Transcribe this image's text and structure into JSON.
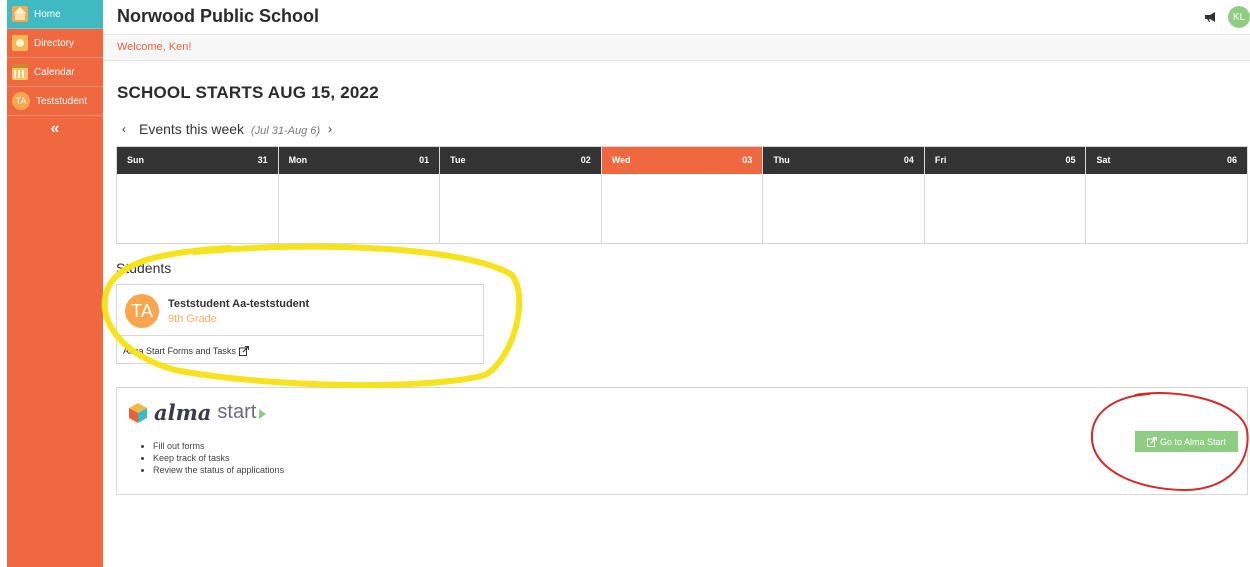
{
  "sidebar": {
    "items": [
      {
        "label": "Home",
        "icon": "home-icon"
      },
      {
        "label": "Directory",
        "icon": "directory-icon"
      },
      {
        "label": "Calendar",
        "icon": "calendar-icon"
      },
      {
        "label": "Teststudent",
        "icon": "avatar",
        "initials": "TA"
      }
    ],
    "collapse_label": "«"
  },
  "header": {
    "title": "Norwood Public School",
    "user_initials": "KL"
  },
  "welcome": "Welcome, Ken!",
  "headline": "SCHOOL STARTS AUG 15, 2022",
  "events": {
    "prev": "‹",
    "title": "Events this week",
    "range": "(Jul 31-Aug 6)",
    "next": "›",
    "days": [
      {
        "name": "Sun",
        "date": "31"
      },
      {
        "name": "Mon",
        "date": "01"
      },
      {
        "name": "Tue",
        "date": "02"
      },
      {
        "name": "Wed",
        "date": "03"
      },
      {
        "name": "Thu",
        "date": "04"
      },
      {
        "name": "Fri",
        "date": "05"
      },
      {
        "name": "Sat",
        "date": "06"
      }
    ]
  },
  "students": {
    "title": "Students",
    "student": {
      "initials": "TA",
      "name": "Teststudent Aa-teststudent",
      "grade": "9th Grade"
    },
    "link": "Alma Start Forms and Tasks"
  },
  "alma_start": {
    "brand": "alma",
    "product": "start",
    "bullets": [
      "Fill out forms",
      "Keep track of tasks",
      "Review the status of applications"
    ],
    "button": "Go to Alma Start"
  },
  "colors": {
    "sidebar": "#f0683f",
    "active": "#3fbac2",
    "today": "#f0683f",
    "button": "#8fce82",
    "highlight": "#f7e31d",
    "circle": "#d32a2a"
  }
}
